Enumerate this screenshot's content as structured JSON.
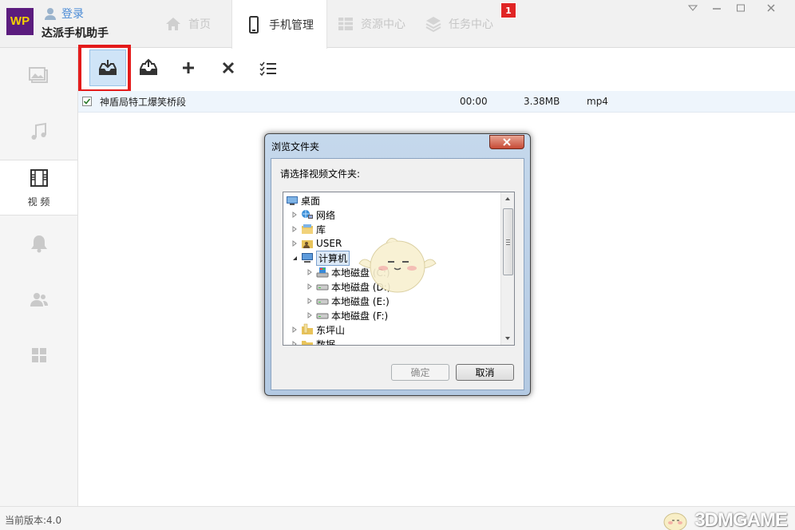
{
  "app": {
    "logo_text": "WP",
    "login_label": "登录",
    "name": "达派手机助手",
    "version": "当前版本:4.0"
  },
  "tabs": [
    {
      "label": "首页",
      "icon": "home-icon"
    },
    {
      "label": "手机管理",
      "icon": "phone-icon"
    },
    {
      "label": "资源中心",
      "icon": "grid-icon"
    },
    {
      "label": "任务中心",
      "icon": "layers-icon"
    }
  ],
  "task_badge": "1",
  "sidebar": [
    {
      "icon": "picture-icon",
      "label": ""
    },
    {
      "icon": "music-icon",
      "label": ""
    },
    {
      "icon": "film-icon",
      "label": "视 频"
    },
    {
      "icon": "bell-icon",
      "label": ""
    },
    {
      "icon": "contacts-icon",
      "label": ""
    },
    {
      "icon": "apps-icon",
      "label": ""
    }
  ],
  "toolbar": [
    {
      "icon": "import-icon"
    },
    {
      "icon": "export-icon"
    },
    {
      "icon": "plus-icon"
    },
    {
      "icon": "delete-icon"
    },
    {
      "icon": "select-list-icon"
    }
  ],
  "files": [
    {
      "name": "神盾局特工爆笑桥段",
      "duration": "00:00",
      "size": "3.38MB",
      "format": "mp4",
      "checked": true
    }
  ],
  "dialog": {
    "title": "浏览文件夹",
    "prompt": "请选择视频文件夹:",
    "ok_label": "确定",
    "cancel_label": "取消",
    "tree": [
      {
        "label": "桌面",
        "icon": "desktop-icon",
        "expander": "",
        "level": 0
      },
      {
        "label": "网络",
        "icon": "network-icon",
        "expander": "collapsed",
        "level": 1
      },
      {
        "label": "库",
        "icon": "library-icon",
        "expander": "collapsed",
        "level": 1
      },
      {
        "label": "USER",
        "icon": "user-folder-icon",
        "expander": "collapsed",
        "level": 1
      },
      {
        "label": "计算机",
        "icon": "computer-icon",
        "expander": "expanded",
        "level": 1,
        "selected": true
      },
      {
        "label": "本地磁盘 (C:)",
        "icon": "system-drive-icon",
        "expander": "collapsed",
        "level": 2
      },
      {
        "label": "本地磁盘 (D:)",
        "icon": "drive-icon",
        "expander": "collapsed",
        "level": 2
      },
      {
        "label": "本地磁盘 (E:)",
        "icon": "drive-icon",
        "expander": "collapsed",
        "level": 2
      },
      {
        "label": "本地磁盘 (F:)",
        "icon": "drive-icon",
        "expander": "collapsed",
        "level": 2
      },
      {
        "label": "东坪山",
        "icon": "folder-icon",
        "expander": "collapsed",
        "level": 1
      },
      {
        "label": "数据",
        "icon": "folder-icon",
        "expander": "collapsed",
        "level": 1
      }
    ]
  },
  "watermark": "3DMGAME",
  "colors": {
    "accent": "#4a8bd6",
    "highlight_box": "#e41b1b",
    "badge": "#e02424",
    "logo_bg": "#5b1c7e",
    "logo_fg": "#f5d000"
  }
}
